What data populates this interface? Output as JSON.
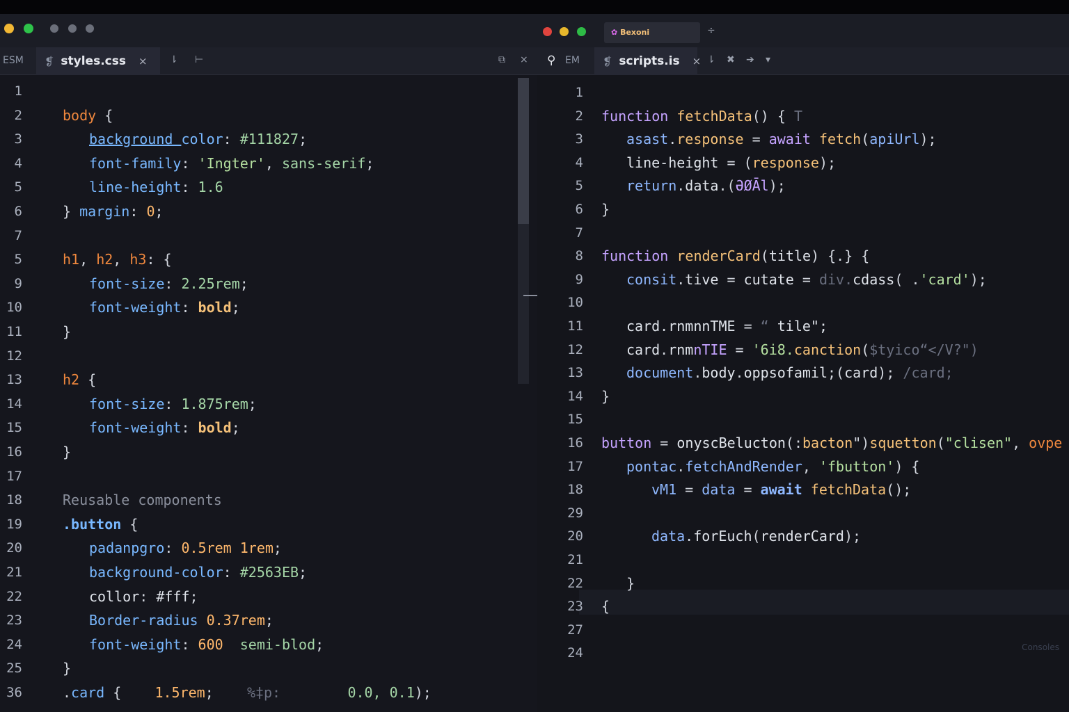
{
  "left": {
    "tab_prefix": "ESM",
    "tab_name": "styles.css",
    "tab_close": "×",
    "tool_filter": "⇂",
    "tool_split": "⊢",
    "tool_popout": "⧉",
    "tool_close": "×",
    "lines": [
      {
        "n": "1",
        "parts": []
      },
      {
        "n": "2",
        "parts": [
          [
            "sel",
            "body"
          ],
          [
            "punc",
            " {"
          ]
        ]
      },
      {
        "n": "3",
        "indent": 2,
        "parts": [
          [
            "prop ul",
            "background "
          ],
          [
            "prop",
            "color"
          ],
          [
            "punc",
            ": "
          ],
          [
            "val",
            "#111827"
          ],
          [
            "punc",
            ";"
          ]
        ]
      },
      {
        "n": "4",
        "indent": 2,
        "parts": [
          [
            "prop",
            "font-family"
          ],
          [
            "punc",
            ": "
          ],
          [
            "str",
            "'Ingter'"
          ],
          [
            "punc",
            ", "
          ],
          [
            "val",
            "sans-serif"
          ],
          [
            "punc",
            ";"
          ]
        ]
      },
      {
        "n": "5",
        "indent": 2,
        "parts": [
          [
            "prop",
            "line-height"
          ],
          [
            "punc",
            ": "
          ],
          [
            "val",
            "1.6"
          ]
        ]
      },
      {
        "n": "6",
        "parts": [
          [
            "punc",
            "} "
          ],
          [
            "prop",
            "margin"
          ],
          [
            "punc",
            ": "
          ],
          [
            "num",
            "0"
          ],
          [
            "punc",
            ";"
          ]
        ]
      },
      {
        "n": "7",
        "parts": []
      },
      {
        "n": "5",
        "parts": [
          [
            "sel",
            "h1"
          ],
          [
            "punc",
            ", "
          ],
          [
            "sel",
            "h2"
          ],
          [
            "punc",
            ", "
          ],
          [
            "sel",
            "h3"
          ],
          [
            "punc",
            ": {"
          ]
        ]
      },
      {
        "n": "9",
        "indent": 2,
        "parts": [
          [
            "prop",
            "font-size"
          ],
          [
            "punc",
            ": "
          ],
          [
            "val",
            "2.25rem"
          ],
          [
            "punc",
            ";"
          ]
        ]
      },
      {
        "n": "10",
        "indent": 2,
        "parts": [
          [
            "prop",
            "font-weight"
          ],
          [
            "punc",
            ": "
          ],
          [
            "fn bold",
            "bold"
          ],
          [
            "punc",
            ";"
          ]
        ]
      },
      {
        "n": "11",
        "parts": [
          [
            "punc",
            "}"
          ]
        ]
      },
      {
        "n": "12",
        "parts": []
      },
      {
        "n": "13",
        "parts": [
          [
            "sel",
            "h2"
          ],
          [
            "punc",
            " {"
          ]
        ]
      },
      {
        "n": "14",
        "indent": 2,
        "parts": [
          [
            "prop",
            "font-size"
          ],
          [
            "punc",
            ": "
          ],
          [
            "val",
            "1.875rem"
          ],
          [
            "punc",
            ";"
          ]
        ]
      },
      {
        "n": "15",
        "indent": 2,
        "parts": [
          [
            "prop",
            "font-weight"
          ],
          [
            "punc",
            ": "
          ],
          [
            "fn bold",
            "bold"
          ],
          [
            "punc",
            ";"
          ]
        ]
      },
      {
        "n": "16",
        "parts": [
          [
            "punc",
            "}"
          ]
        ]
      },
      {
        "n": "17",
        "parts": []
      },
      {
        "n": "18",
        "parts": [
          [
            "cmt",
            "Reusable components"
          ]
        ]
      },
      {
        "n": "19",
        "parts": [
          [
            "prop bold",
            ".button"
          ],
          [
            "punc",
            " {"
          ]
        ]
      },
      {
        "n": "20",
        "indent": 2,
        "parts": [
          [
            "prop",
            "padanpgro"
          ],
          [
            "punc",
            ": "
          ],
          [
            "num",
            "0.5rem 1rem"
          ],
          [
            "punc",
            ";"
          ]
        ]
      },
      {
        "n": "21",
        "indent": 2,
        "parts": [
          [
            "prop",
            "background-color"
          ],
          [
            "punc",
            ": "
          ],
          [
            "val",
            "#2563EB"
          ],
          [
            "punc",
            ";"
          ]
        ]
      },
      {
        "n": "22",
        "indent": 2,
        "parts": [
          [
            "plain",
            "collor"
          ],
          [
            "punc",
            ": "
          ],
          [
            "plain",
            "#fff"
          ],
          [
            "punc",
            ";"
          ]
        ]
      },
      {
        "n": "23",
        "indent": 2,
        "parts": [
          [
            "prop",
            "Border-radius "
          ],
          [
            "num",
            "0.37rem"
          ],
          [
            "punc",
            ";"
          ]
        ]
      },
      {
        "n": "24",
        "indent": 2,
        "parts": [
          [
            "prop",
            "font-weight"
          ],
          [
            "punc",
            ": "
          ],
          [
            "num",
            "600 "
          ],
          [
            "val",
            " semi-blod"
          ],
          [
            "punc",
            ";"
          ]
        ]
      },
      {
        "n": "25",
        "parts": [
          [
            "punc",
            "}"
          ]
        ]
      },
      {
        "n": "36",
        "parts": [
          [
            "punc",
            "."
          ],
          [
            "prop",
            "card"
          ],
          [
            "punc",
            " {    "
          ],
          [
            "num",
            "1.5rem"
          ],
          [
            "punc",
            ";    "
          ],
          [
            "dim",
            "%‡p:        "
          ],
          [
            "val",
            "0.0, 0.1"
          ],
          [
            "punc",
            ");"
          ]
        ]
      }
    ]
  },
  "right": {
    "window_tab": "Bexoni",
    "tab_prefix": "EM",
    "tab_name": "scripts.is",
    "tab_close": "×",
    "tool_filter": "⇂",
    "tool_pin": "✖",
    "tool_go": "➔",
    "tool_more": "▾",
    "tool_split": "÷",
    "lines": [
      {
        "n": "1",
        "parts": []
      },
      {
        "n": "2",
        "parts": [
          [
            "kw",
            "function "
          ],
          [
            "fn",
            "fetchData"
          ],
          [
            "punc",
            "() { "
          ],
          [
            "dim",
            "T"
          ]
        ]
      },
      {
        "n": "3",
        "indent": 2,
        "parts": [
          [
            "ident",
            "asast"
          ],
          [
            "punc",
            "."
          ],
          [
            "fn",
            "response"
          ],
          [
            "punc",
            " = "
          ],
          [
            "kw",
            "await "
          ],
          [
            "fn",
            "fetch"
          ],
          [
            "punc",
            "("
          ],
          [
            "ident",
            "apiUrl"
          ],
          [
            "punc",
            ");"
          ]
        ]
      },
      {
        "n": "4",
        "indent": 2,
        "parts": [
          [
            "plain",
            "line-height"
          ],
          [
            "punc",
            " = ("
          ],
          [
            "fn",
            "response"
          ],
          [
            "punc",
            ");"
          ]
        ]
      },
      {
        "n": "5",
        "indent": 2,
        "parts": [
          [
            "ident",
            "return"
          ],
          [
            "punc",
            "."
          ],
          [
            "plain",
            "data"
          ],
          [
            "punc",
            ".("
          ],
          [
            "kw",
            "ƏØĀl"
          ],
          [
            "punc",
            ");"
          ]
        ]
      },
      {
        "n": "6",
        "parts": [
          [
            "punc",
            "}"
          ]
        ]
      },
      {
        "n": "7",
        "parts": []
      },
      {
        "n": "8",
        "parts": [
          [
            "kw",
            "function "
          ],
          [
            "fn",
            "renderCard"
          ],
          [
            "punc",
            "("
          ],
          [
            "plain",
            "title"
          ],
          [
            "punc",
            ") {.} {"
          ]
        ]
      },
      {
        "n": "9",
        "indent": 2,
        "parts": [
          [
            "ident",
            "consit"
          ],
          [
            "punc",
            "."
          ],
          [
            "plain",
            "tive"
          ],
          [
            "punc",
            " = "
          ],
          [
            "plain",
            "cutate"
          ],
          [
            "punc",
            " = "
          ],
          [
            "dim",
            "div."
          ],
          [
            "plain",
            "cdass"
          ],
          [
            "punc",
            "( ."
          ],
          [
            "str",
            "'card'"
          ],
          [
            "punc",
            ");"
          ]
        ]
      },
      {
        "n": "10",
        "parts": []
      },
      {
        "n": "11",
        "indent": 2,
        "parts": [
          [
            "plain",
            "card"
          ],
          [
            "punc",
            "."
          ],
          [
            "plain",
            "rnmnnTME"
          ],
          [
            "punc",
            " = "
          ],
          [
            "dim",
            "“"
          ],
          [
            "plain",
            " tile\";"
          ]
        ]
      },
      {
        "n": "12",
        "indent": 2,
        "parts": [
          [
            "plain",
            "card"
          ],
          [
            "punc",
            "."
          ],
          [
            "plain",
            "rnm"
          ],
          [
            "kw",
            "nTIE"
          ],
          [
            "punc",
            " = "
          ],
          [
            "str",
            "'6i8."
          ],
          [
            "fn",
            "canction"
          ],
          [
            "punc",
            "("
          ],
          [
            "dim",
            "$tyico“</V?\")"
          ]
        ]
      },
      {
        "n": "13",
        "indent": 2,
        "parts": [
          [
            "ident",
            "document"
          ],
          [
            "punc",
            "."
          ],
          [
            "plain",
            "body"
          ],
          [
            "punc",
            "."
          ],
          [
            "plain",
            "oppsofamil"
          ],
          [
            "punc",
            ";("
          ],
          [
            "plain",
            "card"
          ],
          [
            "punc",
            ");"
          ],
          [
            "dim",
            " /card;"
          ]
        ]
      },
      {
        "n": "14",
        "parts": [
          [
            "punc",
            "}"
          ]
        ]
      },
      {
        "n": "15",
        "parts": []
      },
      {
        "n": "16",
        "parts": [
          [
            "kw",
            "button"
          ],
          [
            "punc",
            " = "
          ],
          [
            "plain",
            "onyscBelucton"
          ],
          [
            "punc",
            "(:"
          ],
          [
            "fn",
            "bacton"
          ],
          [
            "punc",
            "\")"
          ],
          [
            "fn",
            "squetton"
          ],
          [
            "punc",
            "("
          ],
          [
            "str",
            "\"clisen\""
          ],
          [
            "punc",
            ", "
          ],
          [
            "sel",
            "ovpe"
          ],
          [
            "punc",
            " {"
          ]
        ]
      },
      {
        "n": "17",
        "indent": 2,
        "parts": [
          [
            "ident",
            "pontac"
          ],
          [
            "punc",
            "."
          ],
          [
            "ident",
            "fetchAndRender"
          ],
          [
            "punc",
            ", "
          ],
          [
            "str",
            "'fbutton'"
          ],
          [
            "punc",
            ") {"
          ]
        ]
      },
      {
        "n": "18",
        "indent": 4,
        "parts": [
          [
            "ident",
            "vM1"
          ],
          [
            "punc",
            " = "
          ],
          [
            "ident",
            "data"
          ],
          [
            "punc",
            " = "
          ],
          [
            "ident bold",
            "await "
          ],
          [
            "fn",
            "fetchData"
          ],
          [
            "punc",
            "();"
          ]
        ]
      },
      {
        "n": "29",
        "parts": []
      },
      {
        "n": "20",
        "indent": 4,
        "parts": [
          [
            "ident",
            "data"
          ],
          [
            "punc",
            "."
          ],
          [
            "plain",
            "forEuch"
          ],
          [
            "punc",
            "("
          ],
          [
            "plain",
            "renderCard"
          ],
          [
            "punc",
            ");"
          ]
        ]
      },
      {
        "n": "21",
        "parts": []
      },
      {
        "n": "22",
        "indent": 2,
        "parts": [
          [
            "punc",
            "}"
          ]
        ]
      },
      {
        "n": "23",
        "parts": [
          [
            "punc",
            "{"
          ]
        ]
      },
      {
        "n": "27",
        "parts": []
      },
      {
        "n": "24",
        "parts": []
      }
    ]
  },
  "statusbar_hint": "Consoles"
}
